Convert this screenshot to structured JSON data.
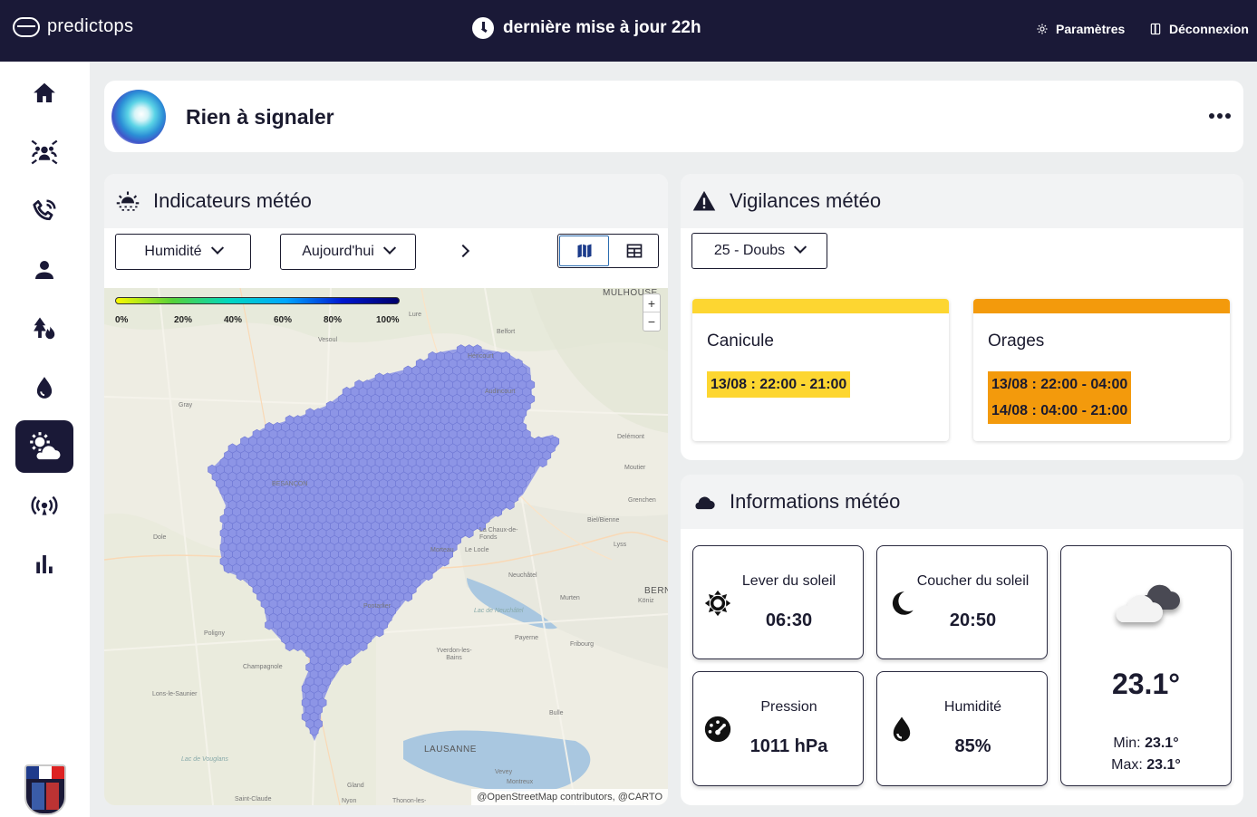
{
  "header": {
    "logo_text": "predictops",
    "update_text": "dernière mise à jour 22h",
    "settings_label": "Paramètres",
    "logout_label": "Déconnexion"
  },
  "sidebar": {
    "items": [
      {
        "icon": "home-icon"
      },
      {
        "icon": "crowd-icon"
      },
      {
        "icon": "phone-call-icon"
      },
      {
        "icon": "person-icon"
      },
      {
        "icon": "forest-fire-icon"
      },
      {
        "icon": "water-drop-icon"
      },
      {
        "icon": "weather-icon",
        "active": true
      },
      {
        "icon": "broadcast-icon"
      },
      {
        "icon": "bar-chart-icon"
      }
    ]
  },
  "alert": {
    "title": "Rien à signaler"
  },
  "meteo_indicators": {
    "title": "Indicateurs météo",
    "indicator_select": "Humidité",
    "period_select": "Aujourd'hui",
    "view_mode": "map",
    "legend": {
      "ticks": [
        "0%",
        "20%",
        "40%",
        "60%",
        "80%",
        "100%"
      ]
    },
    "map": {
      "place_labels": [
        "MULHOUSE",
        "Lure",
        "Belfort",
        "Vesoul",
        "Héricourt",
        "Audincourt",
        "Gray",
        "BESANÇON",
        "Delémont",
        "Moutier",
        "Grenchen",
        "Biel/Bienne",
        "Dole",
        "La Chaux-de-Fonds",
        "Lyss",
        "Morteau",
        "Le Locle",
        "Neuchâtel",
        "BERN",
        "Köniz",
        "Murten",
        "Pontarlier",
        "Lac de Neuchâtel",
        "Poligny",
        "Payerne",
        "Fribourg",
        "Champagnole",
        "Yverdon-les-Bains",
        "Lons-le-Saunier",
        "Bulle",
        "Lac de Vouglans",
        "LAUSANNE",
        "Vevey",
        "Montreux",
        "Gland",
        "Saint-Claude",
        "Nyon",
        "Thonon-les-"
      ],
      "attribution": "@OpenStreetMap contributors, @CARTO"
    }
  },
  "vigilance": {
    "title": "Vigilances météo",
    "department_select": "25 - Doubs",
    "cards": [
      {
        "title": "Canicule",
        "level_color": "#fdd631",
        "periods": [
          "13/08 : 22:00 - 21:00"
        ]
      },
      {
        "title": "Orages",
        "level_color": "#f39a0c",
        "periods": [
          "13/08 : 22:00 - 04:00",
          "14/08 : 04:00 - 21:00"
        ]
      }
    ]
  },
  "weather_info": {
    "title": "Informations météo",
    "sunrise": {
      "label": "Lever du soleil",
      "value": "06:30"
    },
    "sunset": {
      "label": "Coucher du soleil",
      "value": "20:50"
    },
    "pressure": {
      "label": "Pression",
      "value": "1011 hPa"
    },
    "humidity": {
      "label": "Humidité",
      "value": "85%"
    },
    "current": {
      "temperature": "23.1°",
      "min_label": "Min:",
      "min": "23.1°",
      "max_label": "Max:",
      "max": "23.1°",
      "condition_icon": "cloudy-icon"
    }
  },
  "colors": {
    "navbar": "#1a1937",
    "hex_fill": "#8d95e6",
    "vigilance_yellow": "#fdd631",
    "vigilance_orange": "#f39a0c"
  }
}
